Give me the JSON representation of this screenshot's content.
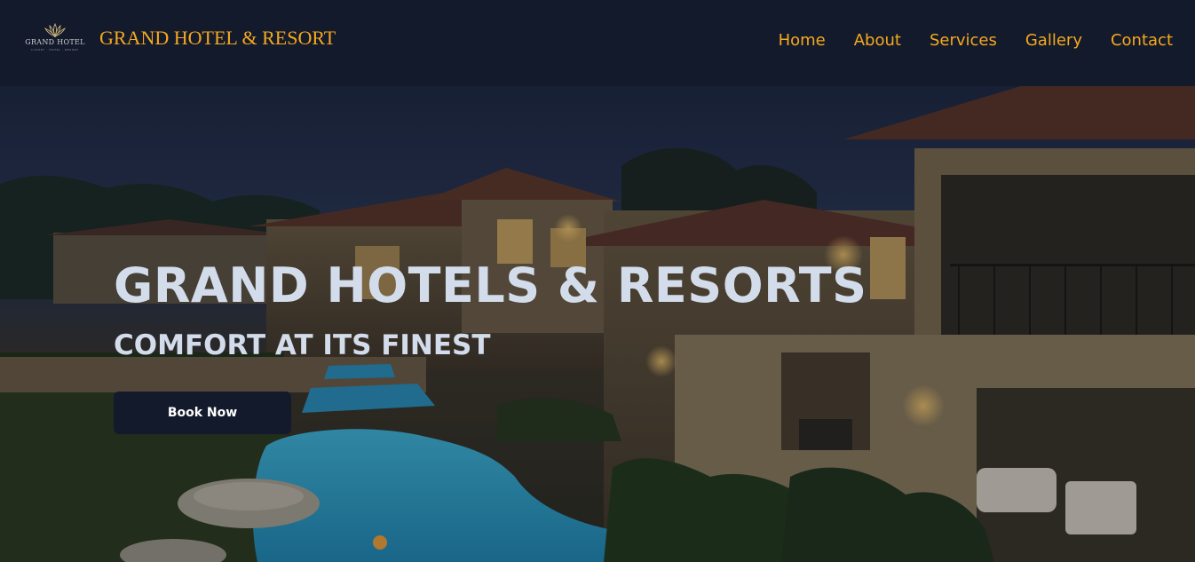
{
  "navbar": {
    "logo": {
      "text": "GRAND HOTEL",
      "sub": "LUXURY · HOTEL · RESORT"
    },
    "brand": "GRAND HOTEL & RESORT",
    "links": [
      "Home",
      "About",
      "Services",
      "Gallery",
      "Contact"
    ]
  },
  "hero": {
    "title": "GRAND HOTELS & RESORTS",
    "subtitle": "COMFORT AT ITS FINEST",
    "cta": "Book Now"
  },
  "colors": {
    "nav_bg": "#131a2c",
    "accent": "#f6a81e",
    "hero_text": "#d3dcea",
    "button_bg": "#131a2c"
  }
}
